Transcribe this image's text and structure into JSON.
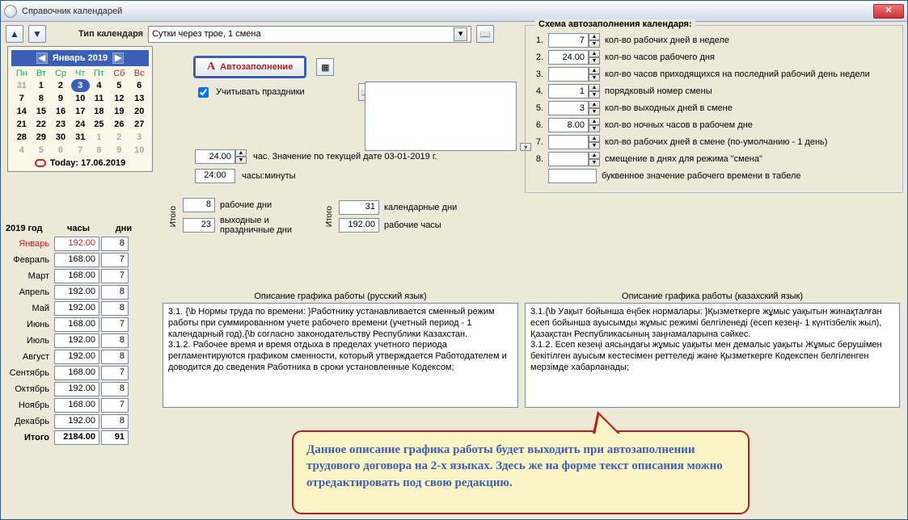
{
  "window": {
    "title": "Справочник календарей"
  },
  "toolbar": {
    "type_label": "Тип календаря",
    "type_value": "Сутки через трое, 1 смена"
  },
  "calendar": {
    "title": "Январь 2019",
    "dow": [
      "Пн",
      "Вт",
      "Ср",
      "Чт",
      "Пт",
      "Сб",
      "Вс"
    ],
    "grid": [
      [
        "31",
        "1",
        "2",
        "3",
        "4",
        "5",
        "6"
      ],
      [
        "7",
        "8",
        "9",
        "10",
        "11",
        "12",
        "13"
      ],
      [
        "14",
        "15",
        "16",
        "17",
        "18",
        "19",
        "20"
      ],
      [
        "21",
        "22",
        "23",
        "24",
        "25",
        "26",
        "27"
      ],
      [
        "28",
        "29",
        "30",
        "31",
        "1",
        "2",
        "3"
      ],
      [
        "4",
        "5",
        "6",
        "7",
        "8",
        "9",
        "10"
      ]
    ],
    "today": "Today: 17.06.2019",
    "selected": "3"
  },
  "months": {
    "year": "2019 год",
    "col_hours": "часы",
    "col_days": "дни",
    "rows": [
      {
        "name": "Январь",
        "hours": "192.00",
        "days": "8",
        "sel": true
      },
      {
        "name": "Февраль",
        "hours": "168.00",
        "days": "7"
      },
      {
        "name": "Март",
        "hours": "168.00",
        "days": "7"
      },
      {
        "name": "Апрель",
        "hours": "192.00",
        "days": "8"
      },
      {
        "name": "Май",
        "hours": "192.00",
        "days": "8"
      },
      {
        "name": "Июнь",
        "hours": "168.00",
        "days": "7"
      },
      {
        "name": "Июль",
        "hours": "192.00",
        "days": "8"
      },
      {
        "name": "Август",
        "hours": "192.00",
        "days": "8"
      },
      {
        "name": "Сентябрь",
        "hours": "168.00",
        "days": "7"
      },
      {
        "name": "Октябрь",
        "hours": "192.00",
        "days": "8"
      },
      {
        "name": "Ноябрь",
        "hours": "168.00",
        "days": "7"
      },
      {
        "name": "Декабрь",
        "hours": "192.00",
        "days": "8"
      }
    ],
    "total_label": "Итого",
    "total_hours": "2184.00",
    "total_days": "91"
  },
  "center": {
    "autofill": "Автозаполнение",
    "holidays_cb": "Учитывать праздники",
    "hours_val": "24.00",
    "hours_lab": "час. Значение по текущей дате 03-01-2019 г.",
    "hhmm_val": "24:00",
    "hhmm_lab": "часы:минуты",
    "totals_label": "Итого",
    "work_days_val": "8",
    "work_days_lab": "рабочие дни",
    "off_days_val": "23",
    "off_days_lab": "выходные и праздничные дни",
    "cal_days_val": "31",
    "cal_days_lab": "календарные дни",
    "work_hours_val": "192.00",
    "work_hours_lab": "рабочие часы"
  },
  "scheme": {
    "legend": "Схема автозаполнения календаря:",
    "rows": [
      {
        "n": "1.",
        "v": "7",
        "lab": "кол-во рабочих дней в неделе"
      },
      {
        "n": "2.",
        "v": "24.00",
        "lab": "кол-во часов рабочего дня"
      },
      {
        "n": "3.",
        "v": "",
        "lab": "кол-во часов приходящихся на последний рабочий день недели"
      },
      {
        "n": "4.",
        "v": "1",
        "lab": "порядковый номер смены"
      },
      {
        "n": "5.",
        "v": "3",
        "lab": "кол-во выходных дней в смене"
      },
      {
        "n": "6.",
        "v": "8.00",
        "lab": "кол-во ночных часов в рабочем дне"
      },
      {
        "n": "7.",
        "v": "",
        "lab": "кол-во рабочих дней в смене (по-умолчанию - 1 день)"
      },
      {
        "n": "8.",
        "v": "",
        "lab": "смещение в днях для режима \"смена\""
      }
    ],
    "letter_lab": "буквенное значение рабочего времени в табеле"
  },
  "desc": {
    "title_ru": "Описание графика работы (русский язык)",
    "title_kz": "Описание графика работы (казахский язык)",
    "ru": "3.1. {\\b Нормы труда по времени: }Работнику устанавливается сменный режим работы при суммированном учете рабочего времени (учетный период - 1 календарный год),{\\b  согласно законодательству Республики Казахстан.\n3.1.2. Рабочее время и время отдыха в пределах учетного периода регламентируются графиком сменности, который утверждается Работодателем и доводится до сведения Работника в сроки установленные Кодексом;",
    "kz": "3.1.{\\b  Уақыт бойынша еңбек нормалары: }Қызметкерге жұмыс уақытын жинақталған есеп бойынша ауысымды жұмыс режимі белгіленеді (есеп кезеңі- 1 күнтізбелік жыл), Қазақстан Республикасының заңнамаларына сәйкес.\n3.1.2. Есеп кезеңі аясындағы жұмыс уақыты мен демалыс уақыты Жұмыс берушімен бекітілген ауысым кестесімен реттеледі және Қызметкерге Кодекспен белгіленген мерзімде хабарланады;"
  },
  "callout": "Данное описание графика работы будет выходить при автозаполнении трудового договора на 2-х языках. Здесь же на форме текст описания можно отредактировать под свою редакцию."
}
